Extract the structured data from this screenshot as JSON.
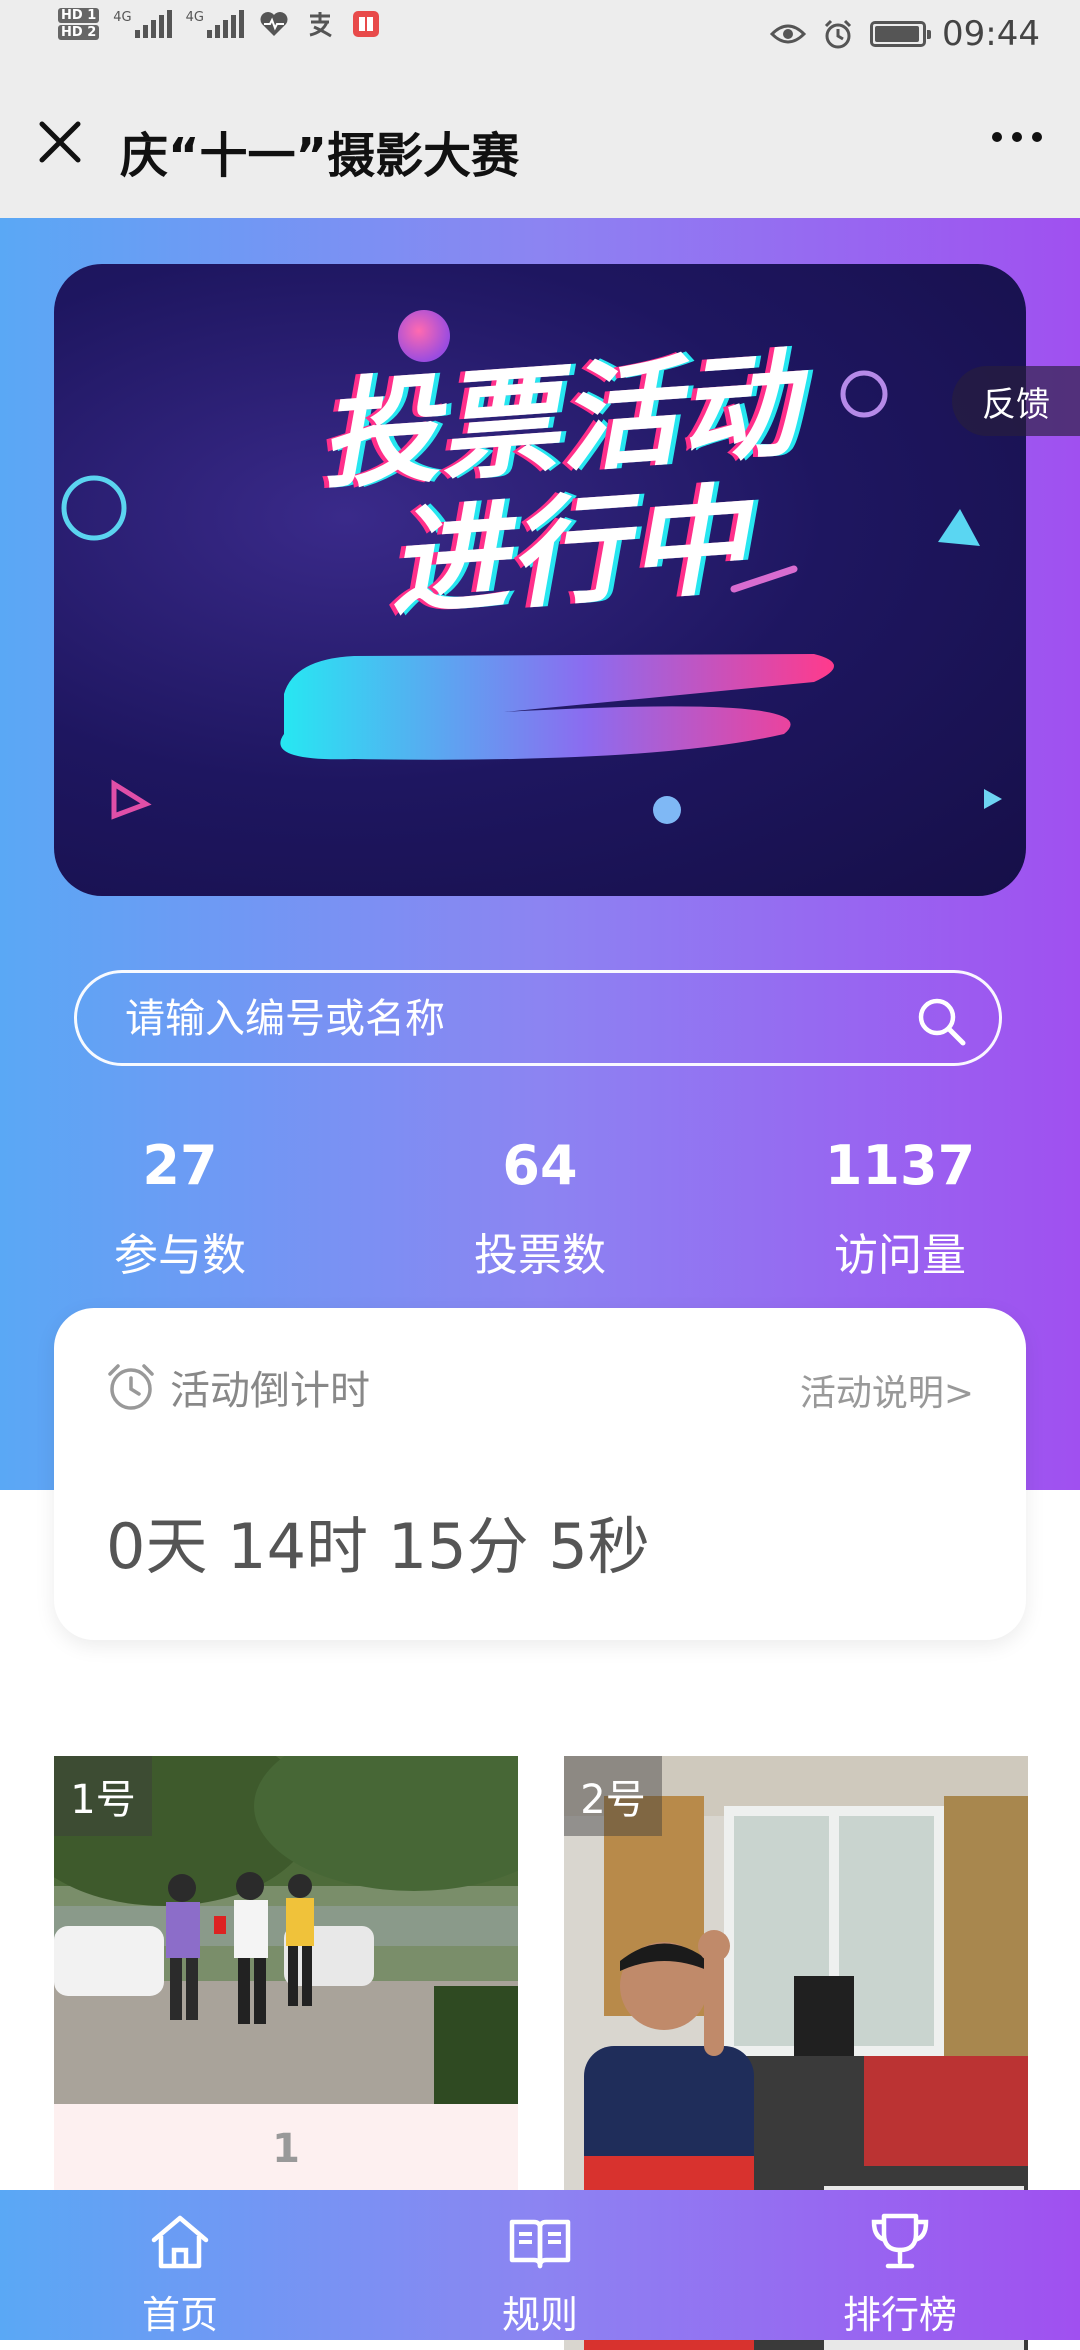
{
  "status_bar": {
    "hd1": "HD 1",
    "hd2": "HD 2",
    "signal_label": "4G",
    "time": "09:44"
  },
  "header": {
    "title": "庆“十一”摄影大赛"
  },
  "banner": {
    "title_line1": "投票活动",
    "title_line2": "进行中"
  },
  "feedback_label": "反馈",
  "search": {
    "placeholder": "请输入编号或名称"
  },
  "stats": [
    {
      "value": "27",
      "label": "参与数"
    },
    {
      "value": "64",
      "label": "投票数"
    },
    {
      "value": "1137",
      "label": "访问量"
    }
  ],
  "countdown": {
    "label": "活动倒计时",
    "link": "活动说明>",
    "value": "0天 14时 15分 5秒"
  },
  "photos": [
    {
      "label": "1号",
      "votes": "1"
    },
    {
      "label": "2号",
      "votes": ""
    }
  ],
  "bottom_nav": [
    {
      "label": "首页",
      "icon": "home-icon"
    },
    {
      "label": "规则",
      "icon": "book-icon"
    },
    {
      "label": "排行榜",
      "icon": "trophy-icon"
    }
  ],
  "colors": {
    "gradient_start": "#5aa8f5",
    "gradient_end": "#a050f0",
    "header_bg": "#ededed"
  }
}
